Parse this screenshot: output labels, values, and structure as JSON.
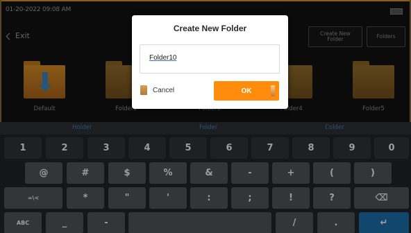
{
  "status_bar": {
    "datetime": "01-20-2022 09:08 AM"
  },
  "header": {
    "exit_label": "Exit",
    "create_new_folder_label_line1": "Create New",
    "create_new_folder_label_line2": "Folder",
    "folders_label": "Folders"
  },
  "folders": [
    {
      "label": "Default",
      "icon": "folder-download-icon",
      "highlight": true
    },
    {
      "label": "Folder2",
      "icon": "folder-icon"
    },
    {
      "label": "Folder3",
      "icon": "folder-icon"
    },
    {
      "label": "Folder4",
      "icon": "folder-icon"
    },
    {
      "label": "Folder5",
      "icon": "folder-icon"
    }
  ],
  "suggestions": [
    "Holder",
    "Folder",
    "Colder"
  ],
  "keyboard": {
    "row1": [
      "1",
      "2",
      "3",
      "4",
      "5",
      "6",
      "7",
      "8",
      "9",
      "0"
    ],
    "row2": [
      "@",
      "#",
      "$",
      "%",
      "&",
      "-",
      "+",
      "(",
      ")"
    ],
    "row3": [
      "=\\<",
      "*",
      "\"",
      "'",
      ":",
      ";",
      "!",
      "?",
      "⌫"
    ],
    "row4": [
      "ABC",
      "_",
      "-",
      "",
      "/",
      ".",
      "↵"
    ]
  },
  "dialog": {
    "title": "Create New Folder",
    "input_value": "Folder10",
    "cancel_label": "Cancel",
    "ok_label": "OK"
  },
  "colors": {
    "accent": "#ff8c0a",
    "enter_key": "#1c6ea8",
    "suggestion_text": "#3f7fc0"
  }
}
